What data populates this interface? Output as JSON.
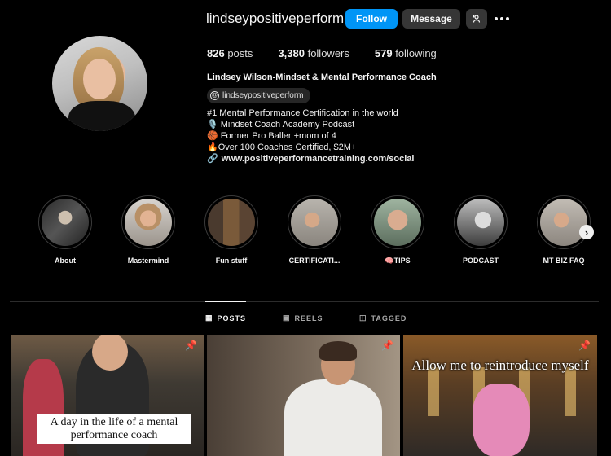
{
  "profile": {
    "username": "lindseypositiveperform",
    "follow_label": "Follow",
    "message_label": "Message",
    "posts_count": "826",
    "posts_label": "posts",
    "followers_count": "3,380",
    "followers_label": "followers",
    "following_count": "579",
    "following_label": "following",
    "full_name": "Lindsey Wilson-Mindset & Mental Performance Coach",
    "threads_handle": "lindseypositiveperform",
    "bio_lines": [
      "#1 Mental Performance Certification in the world",
      "🎙️ Mindset Coach Academy Podcast",
      "🏀 Former Pro Baller +mom of 4",
      "🔥Over 100 Coaches Certified, $2M+"
    ],
    "link": "www.positiveperformancetraining.com/social"
  },
  "highlights": [
    {
      "label": "About"
    },
    {
      "label": "Mastermind"
    },
    {
      "label": "Fun stuff"
    },
    {
      "label": "CERTIFICATI..."
    },
    {
      "label": "🧠TIPS"
    },
    {
      "label": "PODCAST"
    },
    {
      "label": "MT BIZ FAQ"
    }
  ],
  "tabs": [
    {
      "label": "POSTS",
      "icon": "grid-icon",
      "active": true
    },
    {
      "label": "REELS",
      "icon": "reels-icon",
      "active": false
    },
    {
      "label": "TAGGED",
      "icon": "tagged-icon",
      "active": false
    }
  ],
  "posts": [
    {
      "caption": "A day in the life of a mental performance coach",
      "pinned": true
    },
    {
      "caption": "",
      "pinned": true
    },
    {
      "caption": "Allow me to reintroduce myself",
      "pinned": true
    }
  ],
  "colors": {
    "background": "#000000",
    "follow_button": "#0095f6",
    "secondary_button": "#363636"
  }
}
